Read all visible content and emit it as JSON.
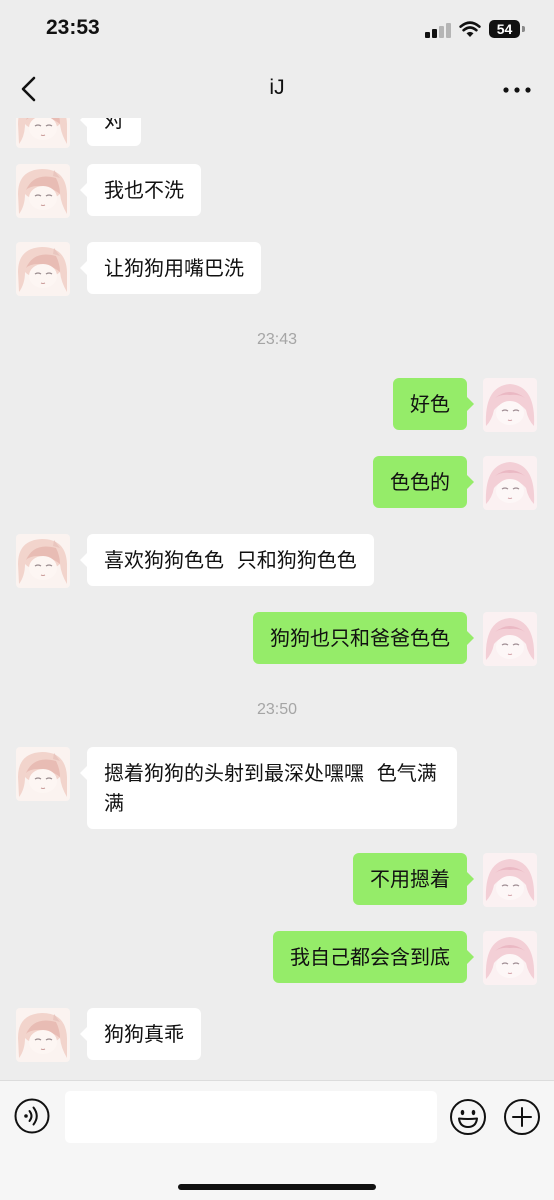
{
  "status_bar": {
    "time": "23:53",
    "battery": "54"
  },
  "nav": {
    "title": "iJ",
    "back_icon": "chevron-left-icon",
    "more_icon": "more-dots-icon"
  },
  "messages": [
    {
      "side": "in",
      "text": "对"
    },
    {
      "side": "in",
      "text": "我也不洗"
    },
    {
      "side": "in",
      "text": "让狗狗用嘴巴洗"
    },
    {
      "timestamp": "23:43"
    },
    {
      "side": "out",
      "text": "好色"
    },
    {
      "side": "out",
      "text": "色色的"
    },
    {
      "side": "in",
      "text": "喜欢狗狗色色  只和狗狗色色"
    },
    {
      "side": "out",
      "text": "狗狗也只和爸爸色色"
    },
    {
      "timestamp": "23:50"
    },
    {
      "side": "in",
      "text": "摁着狗狗的头射到最深处嘿嘿  色气满满"
    },
    {
      "side": "out",
      "text": "不用摁着"
    },
    {
      "side": "out",
      "text": "我自己都会含到底"
    },
    {
      "side": "in",
      "text": "狗狗真乖"
    }
  ],
  "input_bar": {
    "voice_icon": "voice-icon",
    "text_value": "",
    "emoji_icon": "emoji-icon",
    "plus_icon": "plus-icon"
  },
  "colors": {
    "background": "#ededed",
    "bubble_in": "#ffffff",
    "bubble_out": "#95ec69",
    "timestamp": "#a5a5a5"
  }
}
